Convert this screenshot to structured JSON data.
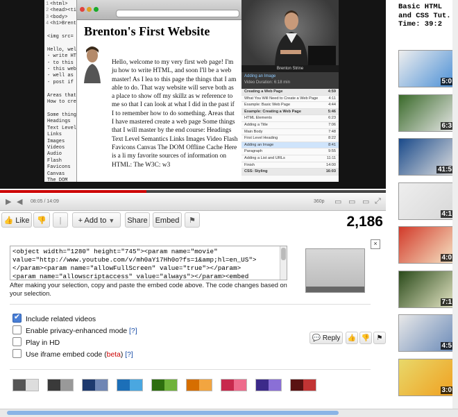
{
  "video": {
    "code_lines": [
      {
        "n": "1",
        "text": "<html>"
      },
      {
        "n": "2",
        "text": "<head><titl"
      },
      {
        "n": "3",
        "text": "<body>"
      },
      {
        "n": "4",
        "text": "<h1>Brenton"
      },
      {
        "n": "",
        "text": ""
      },
      {
        "n": "",
        "text": "<img src="
      },
      {
        "n": "",
        "text": ""
      },
      {
        "n": "",
        "text": "Hello, welc"
      },
      {
        "n": "",
        "text": "- write HTML,"
      },
      {
        "n": "",
        "text": "- to this pag"
      },
      {
        "n": "",
        "text": "- this websit"
      },
      {
        "n": "",
        "text": "- well as a"
      },
      {
        "n": "",
        "text": "- post if I"
      },
      {
        "n": "",
        "text": ""
      },
      {
        "n": "",
        "text": "Areas that"
      },
      {
        "n": "",
        "text": "How to cre"
      },
      {
        "n": "",
        "text": ""
      },
      {
        "n": "",
        "text": "Some thing"
      },
      {
        "n": "",
        "text": "Headings"
      },
      {
        "n": "",
        "text": "Text Level"
      },
      {
        "n": "",
        "text": "Links"
      },
      {
        "n": "",
        "text": "Images"
      },
      {
        "n": "",
        "text": "Videos"
      },
      {
        "n": "",
        "text": "Audio"
      },
      {
        "n": "",
        "text": "Flash"
      },
      {
        "n": "",
        "text": "Favicons"
      },
      {
        "n": "",
        "text": "Canvas"
      },
      {
        "n": "",
        "text": "The DOM"
      }
    ],
    "page_title": "Brenton's First Website",
    "page_body": "Hello, welcome to my very first web page! I'm ju how to write HTML, and soon I'll be a web master! As I lea to this page the things that I am able to do. That way website will serve both as a place to show off my skillz as w reference to me so that I can look at what I did in the past if I to remember how to do something. Areas that I have mastered create a web page Some things that I will master by the end course: Headings Text Level Semantics Links Images Video Flash Favicons Canvas The DOM Offline Cache Here is a li my favorite sources of information on HTML: The W3C: w3",
    "instructor_caption": "Brenton Strine",
    "lesson_header_line1": "Adding an Image",
    "lesson_header_line2": "Video Duration: 6:18 min",
    "toc": [
      {
        "label": "Creating a Web Page",
        "time": "4:59",
        "kind": "section"
      },
      {
        "label": "What You Will Need to Create a Web Page",
        "time": "4:11",
        "kind": "row"
      },
      {
        "label": "Example: Basic Web Page",
        "time": "4:44",
        "kind": "row"
      },
      {
        "label": "Example: Creating a Web Page",
        "time": "5:46",
        "kind": "section"
      },
      {
        "label": "HTML Elements",
        "time": "6:23",
        "kind": "row"
      },
      {
        "label": "Adding a Title",
        "time": "7:06",
        "kind": "row"
      },
      {
        "label": "Main Body",
        "time": "7:48",
        "kind": "row"
      },
      {
        "label": "First Level Heading",
        "time": "8:22",
        "kind": "row"
      },
      {
        "label": "Adding an Image",
        "time": "8:41",
        "kind": "active"
      },
      {
        "label": "Paragraph",
        "time": "9:55",
        "kind": "row"
      },
      {
        "label": "Adding a List and URLs",
        "time": "11:11",
        "kind": "row"
      },
      {
        "label": "Finish",
        "time": "14:00",
        "kind": "row"
      },
      {
        "label": "CSS: Styling",
        "time": "16:03",
        "kind": "section"
      }
    ],
    "progress_fraction": 0.38
  },
  "player": {
    "time": "08:05 / 14:09",
    "quality": "360p"
  },
  "actions": {
    "like_label": "Like",
    "add_to_label": "Add to",
    "share_label": "Share",
    "embed_label": "Embed",
    "view_count": "2,186"
  },
  "embed": {
    "code_lines": [
      "<object width=\"1280\" height=\"745\"><param name=\"movie\"",
      "value=\"http://www.youtube.com/v/mh0aY17Hh0o?fs=1&amp;hl=en_US\">",
      "</param><param name=\"allowFullScreen\" value=\"true\"></param>",
      "<param name=\"allowscriptaccess\" value=\"always\"></param><embed"
    ],
    "hint": "After making your selection, copy and paste the embed code above. The code changes based on your selection.",
    "close_label": "×",
    "options": [
      {
        "label": "Include related videos",
        "checked": true
      },
      {
        "label": "Enable privacy-enhanced mode",
        "suffix": "[?]",
        "checked": false
      },
      {
        "label": "Play in HD",
        "checked": false
      },
      {
        "label": "Use iframe embed code",
        "beta": "beta",
        "suffix": "[?]",
        "checked": false
      }
    ],
    "reply_label": "Reply",
    "swatches": [
      [
        "#555555",
        "#dddddd"
      ],
      [
        "#3a3a3a",
        "#999999"
      ],
      [
        "#1e3a6e",
        "#6f86b4"
      ],
      [
        "#1c6fb8",
        "#4aa7e0"
      ],
      [
        "#2e6e0f",
        "#6fb23a"
      ],
      [
        "#d66e00",
        "#f2a540"
      ],
      [
        "#c8294d",
        "#ee6b8c"
      ],
      [
        "#3c2a8a",
        "#8a6fd6"
      ],
      [
        "#5a1212",
        "#c23434"
      ]
    ]
  },
  "sidebar": {
    "heading": "Basic HTML\nand CSS Tut.\nTime: 39:2",
    "thumbs": [
      {
        "duration": "5:0"
      },
      {
        "duration": "6:3"
      },
      {
        "duration": "41:5"
      },
      {
        "duration": "4:1"
      },
      {
        "duration": "4:0"
      },
      {
        "duration": "7:1"
      },
      {
        "duration": "4:5"
      },
      {
        "duration": "3:0"
      }
    ]
  }
}
